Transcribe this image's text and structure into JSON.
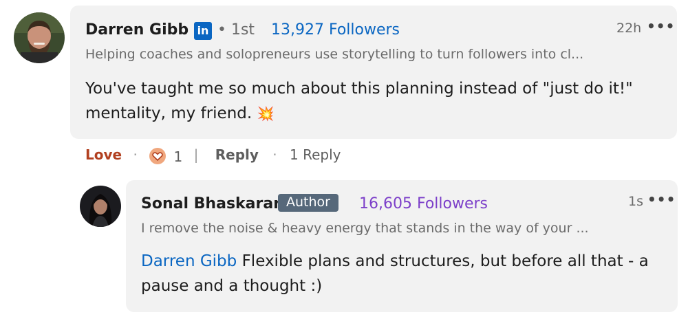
{
  "comment": {
    "author": "Darren Gibb",
    "linkedin_badge": "in",
    "degree": "• 1st",
    "followers": "13,927 Followers",
    "headline": "Helping coaches and solopreneurs use storytelling to turn followers into cl...",
    "text_line1": "You've taught me so much about this planning instead of \"just do it!\"",
    "text_line2": "mentality, my friend.",
    "emoji": "💥",
    "time": "22h",
    "more": "•••",
    "actions": {
      "reaction_label": "Love",
      "dot": "·",
      "reaction_count": "1",
      "divider": "|",
      "reply_label": "Reply",
      "replies_count": "1 Reply"
    }
  },
  "reply": {
    "author": "Sonal Bhaskaran",
    "author_badge": "Author",
    "followers": "16,605 Followers",
    "headline": "I remove the noise & heavy energy that stands in the way of your ...",
    "mention": "Darren Gibb",
    "text_line1": "Flexible plans and structures, but before all that - a",
    "text_line2": "pause and a thought :)",
    "time": "1s",
    "more": "•••"
  },
  "colors": {
    "linkedin_blue": "#0a66c2",
    "followers_blue": "#0a66c2",
    "followers_purple": "#7c3fc9",
    "love_red": "#b24020",
    "author_badge_bg": "#56687a",
    "bubble_bg": "#f2f2f2"
  }
}
